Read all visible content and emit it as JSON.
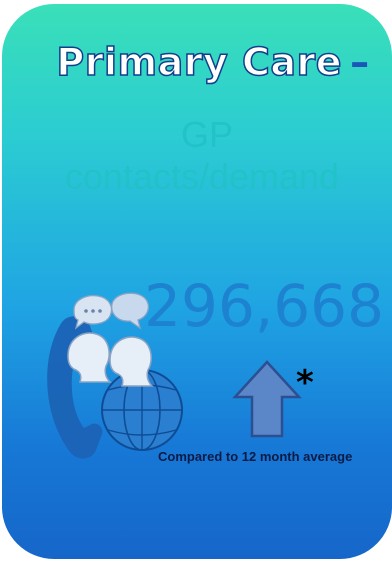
{
  "card": {
    "title": "Primary Care",
    "title_dash": "–",
    "subtitle_line1": "GP",
    "subtitle_line2": "contacts/demand",
    "value": "296,668",
    "trend_direction": "up",
    "asterisk": "*",
    "footnote": "Compared to 12 month average"
  },
  "colors": {
    "card_gradient_top": "#39e0b8",
    "card_gradient_bottom": "#1666c9",
    "title_fill": "#ffffff",
    "title_outline": "#123e8c",
    "value_color": "#1d82d0",
    "arrow_fill": "#5b86c8",
    "arrow_outline": "#2c4f91"
  },
  "icons": {
    "illustration": "people-chat-phone-globe-icon",
    "trend": "arrow-up-icon"
  }
}
